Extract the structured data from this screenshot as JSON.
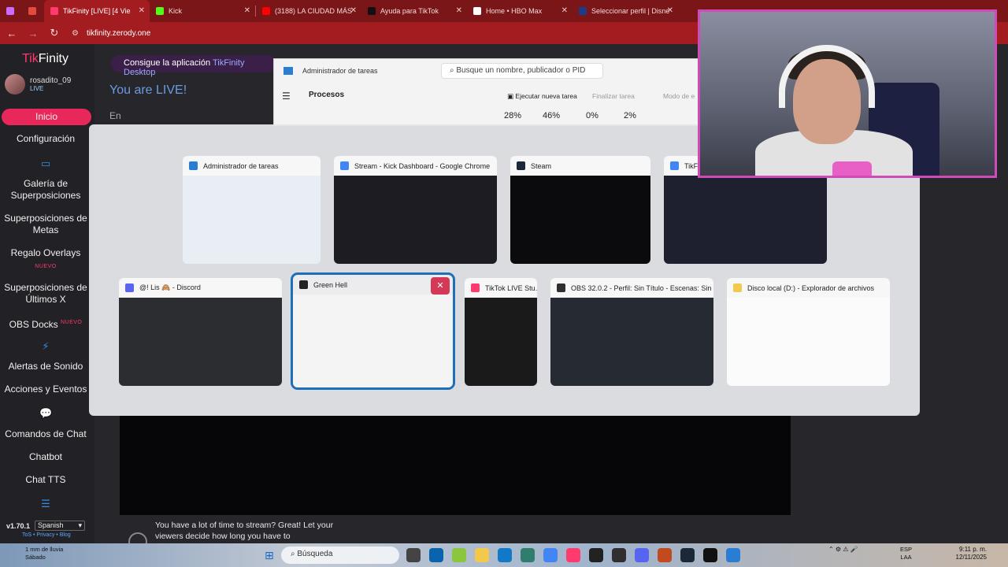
{
  "browser": {
    "tabs": [
      {
        "label": "",
        "color": "#c96cff"
      },
      {
        "label": "",
        "color": "#e24b3b"
      },
      {
        "label": "TikFinity [LIVE] [4 Vie",
        "color": "#ff3a6e",
        "active": true
      },
      {
        "label": "Kick",
        "color": "#53fc18"
      },
      {
        "label": "(3188) LA CIUDAD MÁS",
        "color": "#ff0000"
      },
      {
        "label": "Ayuda para TikTok",
        "color": "#111111"
      },
      {
        "label": "Home • HBO Max",
        "color": "#ffffff"
      },
      {
        "label": "Seleccionar perfil | Disne",
        "color": "#1e3a8a"
      }
    ],
    "url": "tikfinity.zerody.one"
  },
  "sidebar": {
    "logo_tik": "Tik",
    "logo_finity": "Finity",
    "username": "rosadito_09",
    "live": "LIVE",
    "items": [
      {
        "label": "Inicio"
      },
      {
        "label": "Configuración"
      },
      {
        "label": "Galería de Superposiciones"
      },
      {
        "label": "Superposiciones de Metas"
      },
      {
        "label": "Regalo Overlays"
      },
      {
        "label": "Superposiciones de Últimos X"
      },
      {
        "label": "OBS Docks"
      },
      {
        "label": "Alertas de Sonido"
      },
      {
        "label": "Acciones y Eventos"
      },
      {
        "label": "Comandos de Chat"
      },
      {
        "label": "Chatbot"
      },
      {
        "label": "Chat TTS"
      }
    ],
    "new_badge": "NUEVO",
    "version": "v1.70.1",
    "language": "Spanish",
    "footer": "ToS • Privacy • Blog"
  },
  "main": {
    "banner_text": "Consigue la aplicación ",
    "banner_accent": "TikFinity Desktop",
    "live_title": "You are LIVE!",
    "en_label": "En",
    "tip": "You have a lot of time to stream? Great! Let your viewers decide how long you have to"
  },
  "taskmgr": {
    "title": "Administrador de tareas",
    "search": "Busque un nombre, publicador o PID",
    "processes": "Procesos",
    "new_task": "Ejecutar nueva tarea",
    "end_task": "Finalizar tarea",
    "mode": "Modo de e",
    "cpu": "28%",
    "mem": "46%",
    "disk": "0%",
    "net": "2%"
  },
  "switcher": {
    "windows": [
      {
        "title": "Administrador de tareas",
        "icon": "taskmgr-icon",
        "color": "#2b7cd3",
        "thumb": "#e9eef5"
      },
      {
        "title": "Stream - Kick Dashboard - Google Chrome",
        "icon": "chrome-icon",
        "color": "#4285f4",
        "thumb": "#1c1c22"
      },
      {
        "title": "Steam",
        "icon": "steam-icon",
        "color": "#1b2838",
        "thumb": "#0b0b0d"
      },
      {
        "title": "TikFi",
        "icon": "chrome-icon",
        "color": "#4285f4",
        "thumb": "#1e2030"
      },
      {
        "title": "@! Lis 🙈 - Discord",
        "icon": "discord-icon",
        "color": "#5865f2",
        "thumb": "#2b2d31"
      },
      {
        "title": "Green Hell",
        "icon": "greenhell-icon",
        "color": "#222222",
        "thumb": "#f4f4f5",
        "selected": true
      },
      {
        "title": "TikTok LIVE Stu...",
        "icon": "tiktok-icon",
        "color": "#ff3a6e",
        "thumb": "#1a1a1a"
      },
      {
        "title": "OBS 32.0.2 - Perfil: Sin Título - Escenas: Sin Título",
        "icon": "obs-icon",
        "color": "#302e31",
        "thumb": "#262a33"
      },
      {
        "title": "Disco local (D:) - Explorador de archivos",
        "icon": "folder-icon",
        "color": "#f2c94c",
        "thumb": "#fbfbfb"
      }
    ],
    "close_label": "✕"
  },
  "taskbar": {
    "weather_line1": "1 mm de lluvia",
    "weather_line2": "Sábado",
    "search": "Búsqueda",
    "lang1": "ESP",
    "lang2": "LAA",
    "time": "9:11 p. m.",
    "date": "12/11/2025"
  }
}
